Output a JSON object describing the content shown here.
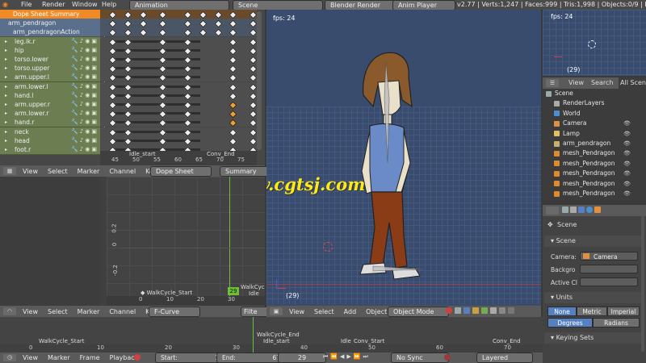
{
  "topbar": {
    "menu": [
      "File",
      "Render",
      "Window",
      "Help"
    ],
    "screen_layout": "Animation",
    "scene": "Scene",
    "engine": "Blender Render",
    "anim_player": "Anim Player",
    "stats": "v2.77 | Verts:1,247 | Faces:999 | Tris:1,998 | Objects:0/9 | Lamps:0/1"
  },
  "dopesheet": {
    "rows": [
      {
        "label": "Dope Sheet Summary",
        "kind": "summary"
      },
      {
        "label": "arm_pendragon",
        "kind": "object"
      },
      {
        "label": "arm_pendragonAction",
        "kind": "action"
      },
      {
        "label": "leg.ik.r",
        "kind": "channel"
      },
      {
        "label": "hip",
        "kind": "channel"
      },
      {
        "label": "torso.lower",
        "kind": "channel"
      },
      {
        "label": "torso.upper",
        "kind": "channel"
      },
      {
        "label": "arm.upper.l",
        "kind": "channel"
      },
      {
        "label": "arm.lower.l",
        "kind": "channel"
      },
      {
        "label": "hand.l",
        "kind": "channel"
      },
      {
        "label": "arm.upper.r",
        "kind": "channel"
      },
      {
        "label": "arm.lower.r",
        "kind": "channel"
      },
      {
        "label": "hand.r",
        "kind": "channel"
      },
      {
        "label": "neck",
        "kind": "channel"
      },
      {
        "label": "head",
        "kind": "channel"
      },
      {
        "label": "foot.r",
        "kind": "channel"
      }
    ],
    "ruler": [
      "45",
      "50",
      "55",
      "60",
      "65",
      "70",
      "75"
    ],
    "markers": [
      "Idle_start",
      "Conv_End"
    ],
    "header": {
      "menu": [
        "View",
        "Select",
        "Marker",
        "Channel",
        "Key"
      ],
      "mode": "Dope Sheet",
      "context": "Summary"
    }
  },
  "graph": {
    "yticks": [
      "0.2",
      "0",
      "-0.2"
    ],
    "xticks": [
      "0",
      "10",
      "20",
      "30"
    ],
    "marker": "WalkCycle_Start",
    "current_frame": "29",
    "marker_right": "WalkCycle_",
    "marker_idle": "Idle",
    "header": {
      "menu": [
        "View",
        "Select",
        "Marker",
        "Channel",
        "Key"
      ],
      "mode": "F-Curve",
      "filter": "Filte"
    }
  },
  "viewport": {
    "fps": "fps: 24",
    "frame": "(29)",
    "header": {
      "menu": [
        "View",
        "Select",
        "Add",
        "Object"
      ],
      "mode": "Object Mode"
    }
  },
  "mini_viewport": {
    "fps": "fps: 24",
    "frame": "(29)"
  },
  "outliner": {
    "tabs": [
      "View",
      "Search",
      "All Scenes"
    ],
    "items": [
      "Scene",
      "RenderLayers",
      "World",
      "Camera",
      "Lamp",
      "arm_pendragon",
      "mesh_Pendragon",
      "mesh_Pendragon",
      "mesh_Pendragon",
      "mesh_Pendragon",
      "mesh_Pendragon"
    ]
  },
  "properties": {
    "scene_name": "Scene",
    "scene_panel": "Scene",
    "camera_label": "Camera:",
    "camera_value": "Camera",
    "background_label": "Backgro",
    "active_clip_label": "Active Cl",
    "units_panel": "Units",
    "unit_buttons": [
      "None",
      "Metric",
      "Imperial"
    ],
    "rotation_buttons": [
      "Degrees",
      "Radians"
    ],
    "keying_panel": "Keying Sets"
  },
  "timeline": {
    "markers": [
      "WalkCycle_Start",
      "WalkCycle_End",
      "Idle_start",
      "Idle",
      "Conv_Start",
      "Conv_End"
    ],
    "ticks": [
      "0",
      "10",
      "20",
      "30",
      "40",
      "50",
      "60",
      "70"
    ],
    "header": {
      "menu": [
        "View",
        "Marker",
        "Frame",
        "Playback"
      ],
      "start_label": "Start:",
      "start_value": "1",
      "end_label": "End:",
      "end_value": "67",
      "current": "29",
      "sync": "No Sync",
      "keying": "Layered"
    }
  },
  "watermark": "www.cgtsj.com",
  "colors": {
    "accent": "#f08a24",
    "channel": "#6c7d52",
    "viewport_bg": "#394c6e",
    "selected_button": "#5680c2"
  }
}
